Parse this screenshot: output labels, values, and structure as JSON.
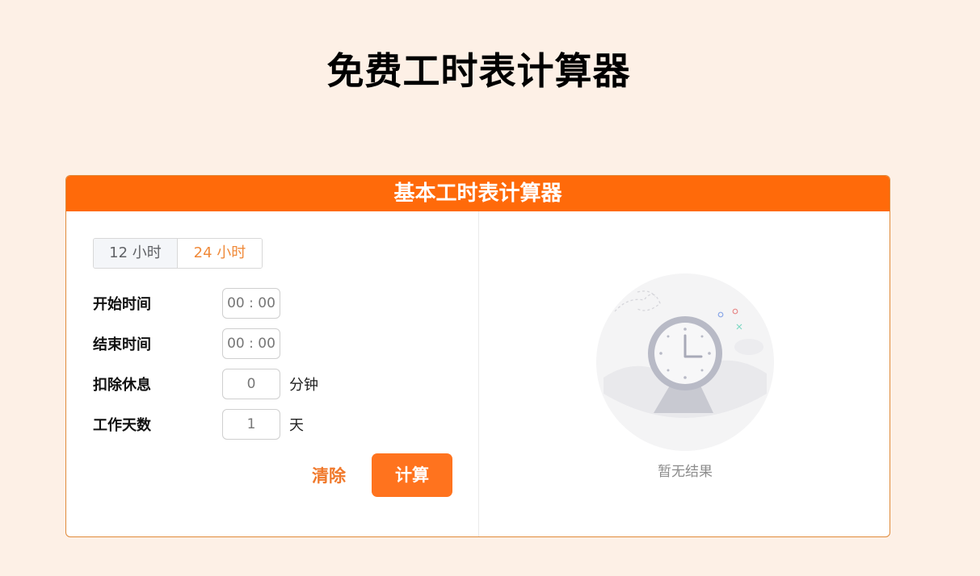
{
  "page": {
    "title": "免费工时表计算器"
  },
  "card": {
    "title": "基本工时表计算器"
  },
  "mode_toggle": {
    "options": [
      "12 小时",
      "24 小时"
    ],
    "selected": "24 小时"
  },
  "form": {
    "start_time": {
      "label": "开始时间",
      "placeholder": "00 : 00"
    },
    "end_time": {
      "label": "结束时间",
      "placeholder": "00 : 00"
    },
    "break": {
      "label": "扣除休息",
      "value": "0",
      "unit": "分钟"
    },
    "work_days": {
      "label": "工作天数",
      "value": "1",
      "unit": "天"
    }
  },
  "actions": {
    "clear_label": "清除",
    "calculate_label": "计算"
  },
  "result": {
    "empty_text": "暂无结果",
    "icon": "clock-empty-illustration"
  },
  "colors": {
    "background": "#fdf0e6",
    "accent": "#ff6a0a",
    "accent_text": "#f08a3a"
  }
}
